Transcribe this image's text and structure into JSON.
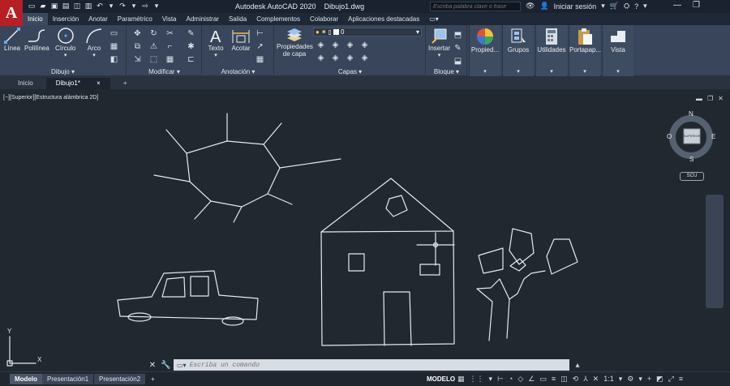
{
  "app": {
    "logo_letter": "A",
    "title": "Autodesk AutoCAD 2020",
    "file": "Dibujo1.dwg",
    "search_placeholder": "Escriba palabra clave o frase",
    "signin": "Iniciar sesión"
  },
  "ribbon_tabs": [
    "Inicio",
    "Inserción",
    "Anotar",
    "Paramétrico",
    "Vista",
    "Administrar",
    "Salida",
    "Complementos",
    "Colaborar",
    "Aplicaciones destacadas"
  ],
  "ribbon": {
    "draw": {
      "linea": "Línea",
      "polilinea": "Polilínea",
      "circulo": "Círculo",
      "arco": "Arco",
      "label": "Dibujo"
    },
    "modify": {
      "label": "Modificar"
    },
    "annotation": {
      "texto": "Texto",
      "acotar": "Acotar",
      "label": "Anotación"
    },
    "layers": {
      "props": "Propiedades de capa",
      "current": "0",
      "label": "Capas"
    },
    "block": {
      "insertar": "Insertar",
      "label": "Bloque"
    },
    "palettes": [
      "Propied...",
      "Grupos",
      "Utilidades",
      "Portapap...",
      "Vista"
    ]
  },
  "doc_tabs": {
    "inicio": "Inicio",
    "dibujo": "Dibujo1*",
    "add": "+"
  },
  "viewport": {
    "label": "[−][Superior][Estructura alámbrica 2D]",
    "compass": {
      "n": "N",
      "s": "S",
      "e": "E",
      "o": "O",
      "cube": "SUPERIOR"
    },
    "scu": "SCU",
    "axis_x": "X",
    "axis_y": "Y"
  },
  "command": {
    "placeholder": "Escriba un comando"
  },
  "layout_tabs": [
    "Modelo",
    "Presentación1",
    "Presentación2"
  ],
  "status": {
    "model": "MODELO",
    "scale": "1:1"
  }
}
